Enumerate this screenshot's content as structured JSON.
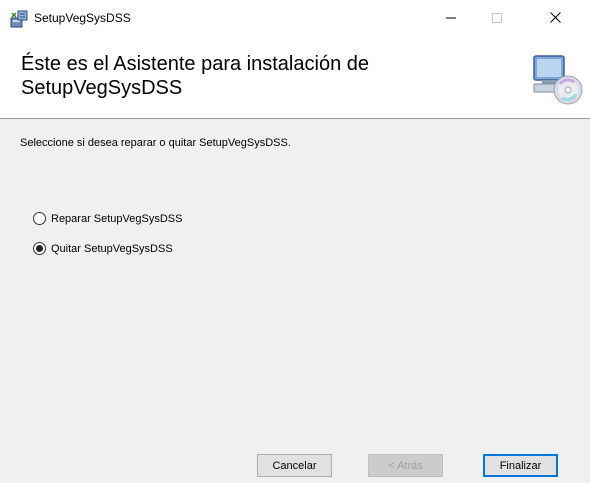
{
  "window": {
    "title": "SetupVegSysDSS",
    "icons": {
      "app": "installer-icon",
      "minimize": "minimize-icon",
      "maximize": "maximize-icon",
      "close": "close-icon"
    }
  },
  "header": {
    "title": "Éste es el Asistente para instalación de SetupVegSysDSS",
    "icon": "computer-cd-icon"
  },
  "main": {
    "instruction": "Seleccione si desea reparar o quitar SetupVegSysDSS.",
    "options": [
      {
        "label": "Reparar SetupVegSysDSS",
        "selected": false
      },
      {
        "label": "Quitar SetupVegSysDSS",
        "selected": true
      }
    ]
  },
  "footer": {
    "cancel_label": "Cancelar",
    "back_label": "< Atrás",
    "finish_label": "Finalizar"
  },
  "colors": {
    "accent": "#0078d7",
    "panel": "#f0f0f0",
    "disabled_text": "#a0a0a0"
  }
}
